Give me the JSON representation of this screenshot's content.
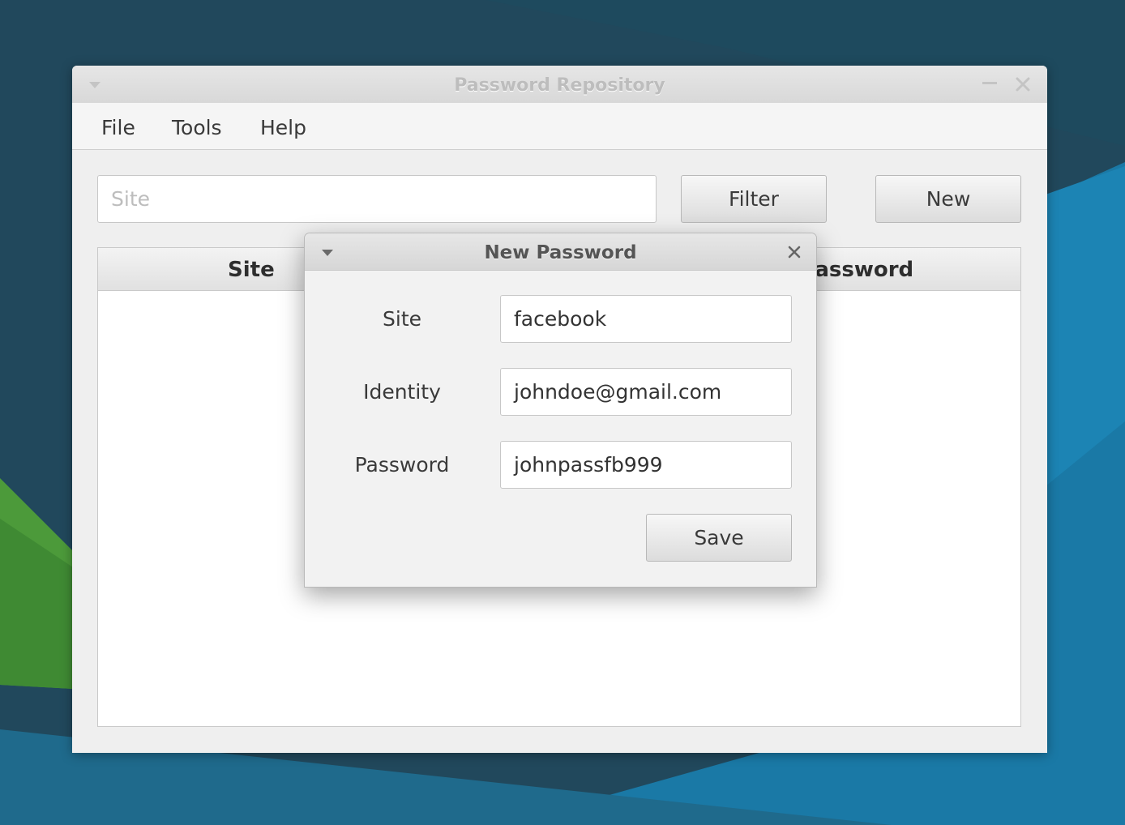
{
  "window": {
    "title": "Password Repository"
  },
  "menu": {
    "items": [
      "File",
      "Tools",
      "Help"
    ]
  },
  "toolbar": {
    "search_placeholder": "Site",
    "filter_label": "Filter",
    "new_label": "New"
  },
  "table": {
    "columns": [
      "Site",
      "Password"
    ]
  },
  "dialog": {
    "title": "New Password",
    "fields": [
      {
        "label": "Site",
        "value": "facebook"
      },
      {
        "label": "Identity",
        "value": "johndoe@gmail.com"
      },
      {
        "label": "Password",
        "value": "johnpassfb999"
      }
    ],
    "save_label": "Save"
  },
  "icons": {
    "window_menu": "chevron-down-icon",
    "minimize": "minimize-icon",
    "close": "close-icon"
  },
  "colors": {
    "desktop_dark": "#1e4558",
    "desktop_blue": "#1a7aa8",
    "desktop_green": "#4d9b3a",
    "window_bg": "#efefef"
  }
}
